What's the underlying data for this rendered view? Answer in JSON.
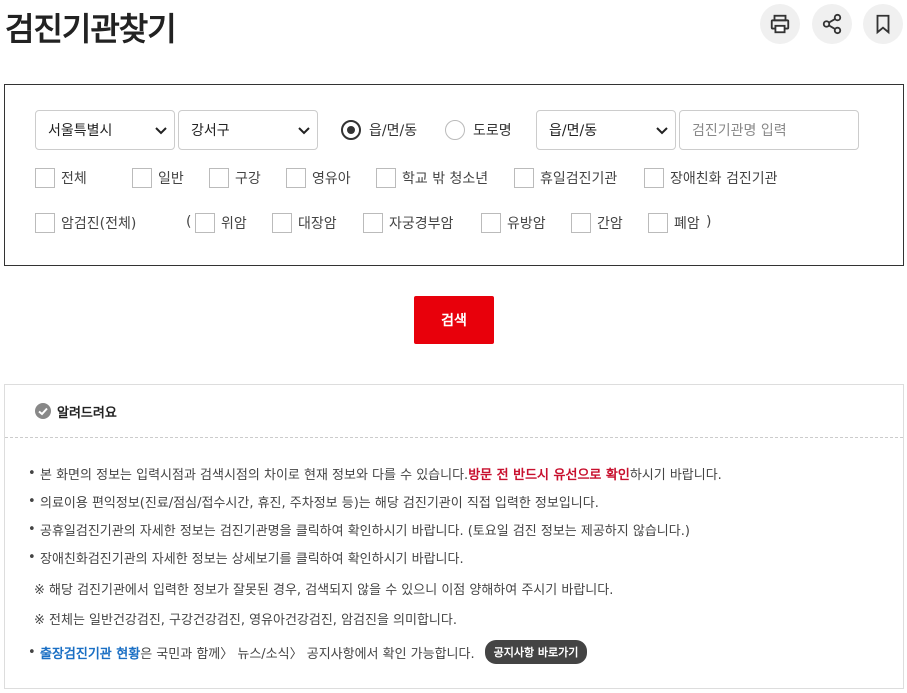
{
  "page": {
    "title": "검진기관찾기"
  },
  "toolbar": {
    "print_icon": "print-icon",
    "share_icon": "share-icon",
    "bookmark_icon": "bookmark-icon"
  },
  "search": {
    "city": "서울특별시",
    "district": "강서구",
    "radio_dong": "읍/면/동",
    "radio_road": "도로명",
    "radio_selected": "dong",
    "dong_select": "읍/면/동",
    "name_placeholder": "검진기관명 입력",
    "types": [
      "전체",
      "일반",
      "구강",
      "영유아",
      "학교 밖 청소년",
      "휴일검진기관",
      "장애친화 검진기관"
    ],
    "cancer_all": "암검진(전체)",
    "paren_open": "(",
    "paren_close": ")",
    "cancers": [
      "위암",
      "대장암",
      "자궁경부암",
      "유방암",
      "간암",
      "폐암"
    ],
    "button": "검색"
  },
  "notice": {
    "title": "알려드려요",
    "lines": [
      {
        "bullet": "•",
        "text": "본 화면의 정보는 입력시점과 검색시점의 차이로 현재 정보와 다를 수 있습니다. ",
        "strong": "방문 전 반드시 유선으로 확인",
        "tail": "하시기 바랍니다."
      },
      {
        "bullet": "•",
        "text": "의료이용 편익정보(진료/점심/접수시간, 휴진, 주차정보 등)는 해당 검진기관이 직접 입력한 정보입니다."
      },
      {
        "bullet": "•",
        "text": "공휴일검진기관의 자세한 정보는 검진기관명을 클릭하여 확인하시기 바랍니다. (토요일 검진 정보는 제공하지 않습니다.)"
      },
      {
        "bullet": "•",
        "text": "장애친화검진기관의 자세한 정보는 상세보기를 클릭하여 확인하시기 바랍니다."
      },
      {
        "bullet": "",
        "text": "※ 해당 검진기관에서 입력한 정보가 잘못된 경우, 검색되지 않을 수 있으니 이점 양해하여 주시기 바랍니다."
      },
      {
        "bullet": "",
        "text": "※ 전체는 일반건강검진, 구강건강검진, 영유아건강검진, 암검진을 의미합니다."
      },
      {
        "bullet": "•",
        "strong": "출장검진기관 현황",
        "text": "은 국민과 함께〉 뉴스/소식〉 공지사항에서 확인 가능합니다.",
        "link": "공지사항 바로가기"
      }
    ]
  }
}
